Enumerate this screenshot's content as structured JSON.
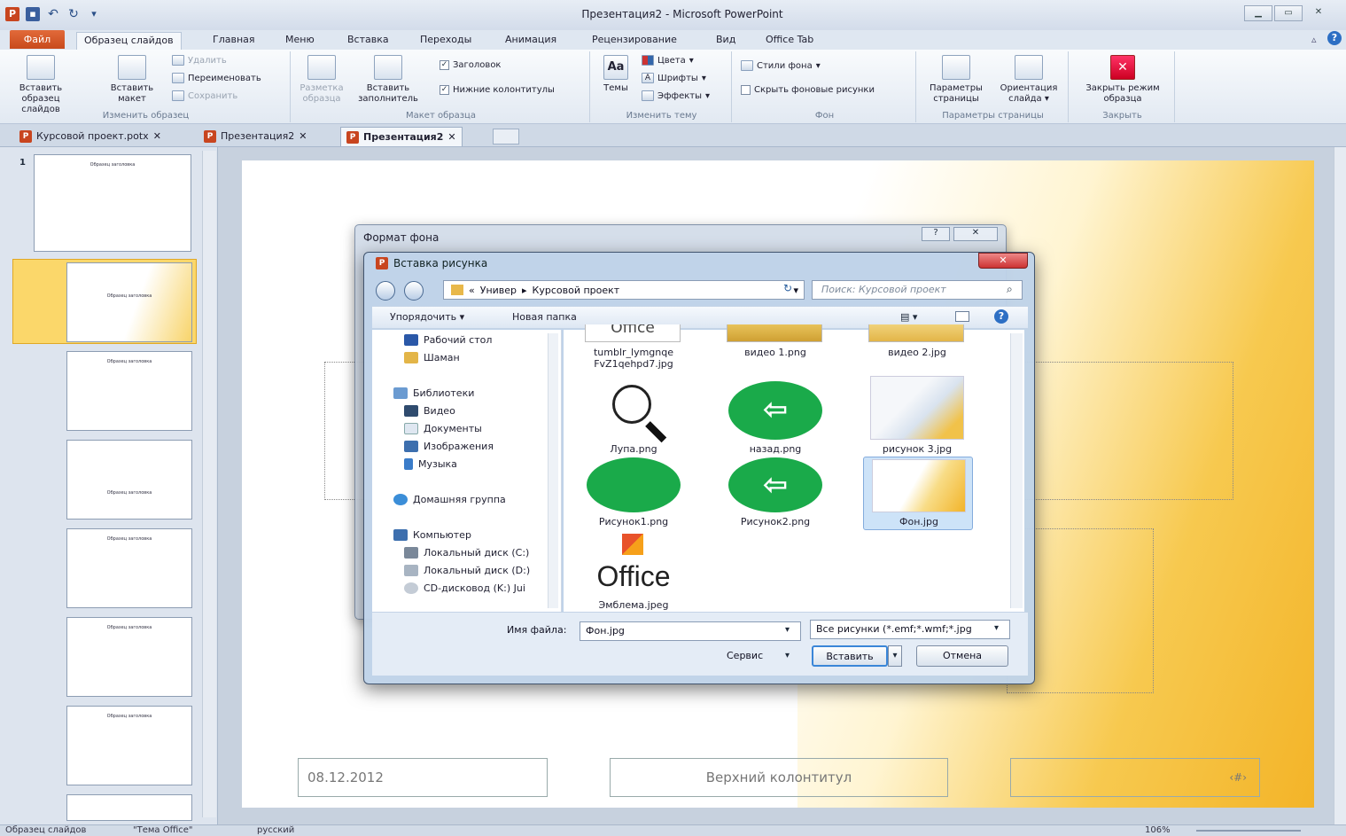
{
  "window": {
    "title": "Презентация2 - Microsoft PowerPoint"
  },
  "qat": {
    "icons": [
      "powerpoint-icon",
      "save-icon",
      "undo-icon",
      "redo-icon",
      "customize-icon"
    ]
  },
  "ribbon_tabs": {
    "file": "Файл",
    "items": [
      "Образец слайдов",
      "Главная",
      "Меню",
      "Вставка",
      "Переходы",
      "Анимация",
      "Рецензирование",
      "Вид",
      "Office Tab"
    ]
  },
  "ribbon": {
    "edit_master": {
      "insert_master": "Вставить образец слайдов",
      "insert_layout": "Вставить макет",
      "delete": "Удалить",
      "rename": "Переименовать",
      "preserve": "Сохранить",
      "label": "Изменить образец"
    },
    "master_layout": {
      "layout": "Разметка образца",
      "insert_placeholder": "Вставить заполнитель",
      "title": "Заголовок",
      "footers": "Нижние колонтитулы",
      "label": "Макет образца"
    },
    "edit_theme": {
      "themes": "Темы",
      "colors": "Цвета",
      "fonts": "Шрифты",
      "effects": "Эффекты",
      "label": "Изменить тему"
    },
    "background": {
      "styles": "Стили фона",
      "hide": "Скрыть фоновые рисунки",
      "label": "Фон"
    },
    "page_setup": {
      "params": "Параметры страницы",
      "orientation": "Ориентация слайда",
      "label": "Параметры страницы"
    },
    "close": {
      "close_master": "Закрыть режим образца",
      "label": "Закрыть"
    }
  },
  "doc_tabs": [
    "Курсовой проект.potx",
    "Презентация2",
    "Презентация2"
  ],
  "thumbs": {
    "t1": "Образец заголовка",
    "t2": "Образец заголовка",
    "t3": "Образец заголовка",
    "t4": "Образец заголовка",
    "t5": "Образец заголовка",
    "t6": "Образец заголовка",
    "t7": "Образец заголовка",
    "num": "1"
  },
  "slide": {
    "date": "08.12.2012",
    "header": "Верхний колонтитул",
    "num": "‹#›"
  },
  "status": {
    "mode": "Образец слайдов",
    "theme": "\"Тема Office\"",
    "lang": "русский",
    "zoom": "106%"
  },
  "format_dialog": {
    "title": "Формат фона"
  },
  "insert_dialog": {
    "title": "Вставка рисунка",
    "address": [
      "«",
      "Универ",
      "▸",
      "Курсовой проект"
    ],
    "search_placeholder": "Поиск: Курсовой проект",
    "organize": "Упорядочить ▾",
    "new_folder": "Новая папка",
    "nav": [
      "Рабочий стол",
      "Шаман",
      "Библиотеки",
      "Видео",
      "Документы",
      "Изображения",
      "Музыка",
      "Домашняя группа",
      "Компьютер",
      "Локальный диск (C:)",
      "Локальный диск (D:)",
      "CD-дисковод (K:) Jui"
    ],
    "files": [
      "tumblr_lymgnqe FvZ1qehpd7.jpg",
      "видео 1.png",
      "видео 2.jpg",
      "Лупа.png",
      "назад.png",
      "рисунок 3.jpg",
      "Рисунок1.png",
      "Рисунок2.png",
      "Фон.jpg",
      "Эмблема.jpeg"
    ],
    "partial_top": "Office",
    "office_logo": "Office",
    "filename_label": "Имя файла:",
    "filename": "Фон.jpg",
    "filetype": "Все рисунки (*.emf;*.wmf;*.jpg",
    "service": "Сервис",
    "insert": "Вставить",
    "cancel": "Отмена"
  },
  "colors": {
    "accent": "#c84a1c",
    "slide_warm": "#f3b428",
    "dialog": "#bed2e8",
    "green": "#1aaa4a"
  }
}
